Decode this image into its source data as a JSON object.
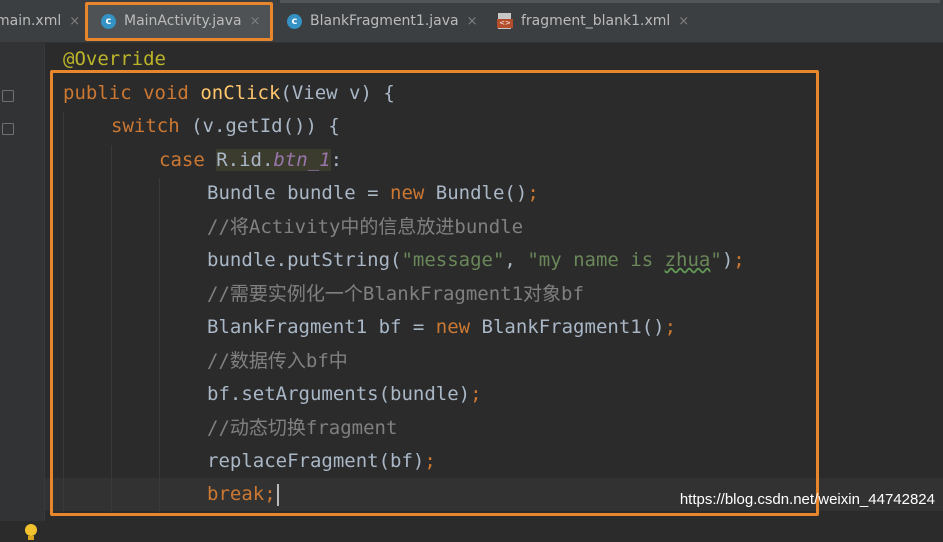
{
  "tabs": [
    {
      "label": "main.xml",
      "type": "xml",
      "close": "×"
    },
    {
      "label": "MainActivity.java",
      "type": "java",
      "close": "×",
      "selected": true
    },
    {
      "label": "BlankFragment1.java",
      "type": "java",
      "close": "×"
    },
    {
      "label": "fragment_blank1.xml",
      "type": "xml",
      "close": "×"
    }
  ],
  "icons": {
    "java_tab": "java-class-icon",
    "xml_tab": "xml-file-icon",
    "gutter": "lightbulb-icon",
    "java_letter": "c",
    "xml_letter": "<>"
  },
  "colors": {
    "highlight_outline": "#e8862c",
    "background": "#2b2b2b",
    "keyword": "#cc7832",
    "method": "#ffc66d",
    "string": "#6a8759",
    "comment": "#808080",
    "annotation": "#bbb529",
    "field": "#9876aa"
  },
  "code": {
    "l1_annotation": "@Override",
    "l2_public": "public",
    "l2_void": "void",
    "l2_method": "onClick",
    "l2_rest": "(View v) {",
    "l3_switch": "switch",
    "l3_rest": " (v.getId()) {",
    "l4_case": "case",
    "l4_ref": "R.id.",
    "l4_field": "btn_1",
    "l4_colon": ":",
    "l5_a": "Bundle bundle = ",
    "l5_new": "new",
    "l5_b": " Bundle()",
    "l5_semi": ";",
    "l6_comment": "//将Activity中的信息放进bundle",
    "l7_a": "bundle.putString(",
    "l7_s1": "\"message\"",
    "l7_comma": ", ",
    "l7_s2a": "\"my name is ",
    "l7_s2b": "zhua",
    "l7_s2c": "\"",
    "l7_b": ")",
    "l7_semi": ";",
    "l8_comment": "//需要实例化一个BlankFragment1对象bf",
    "l9_a": "BlankFragment1 bf = ",
    "l9_new": "new",
    "l9_b": " BlankFragment1()",
    "l9_semi": ";",
    "l10_comment": "//数据传入bf中",
    "l11_a": "bf.setArguments(bundle)",
    "l11_semi": ";",
    "l12_comment": "//动态切换fragment",
    "l13_a": "replaceFragment(bf)",
    "l13_semi": ";",
    "l14_break": "break",
    "l14_semi": ";"
  },
  "watermark": "https://blog.csdn.net/weixin_44742824"
}
